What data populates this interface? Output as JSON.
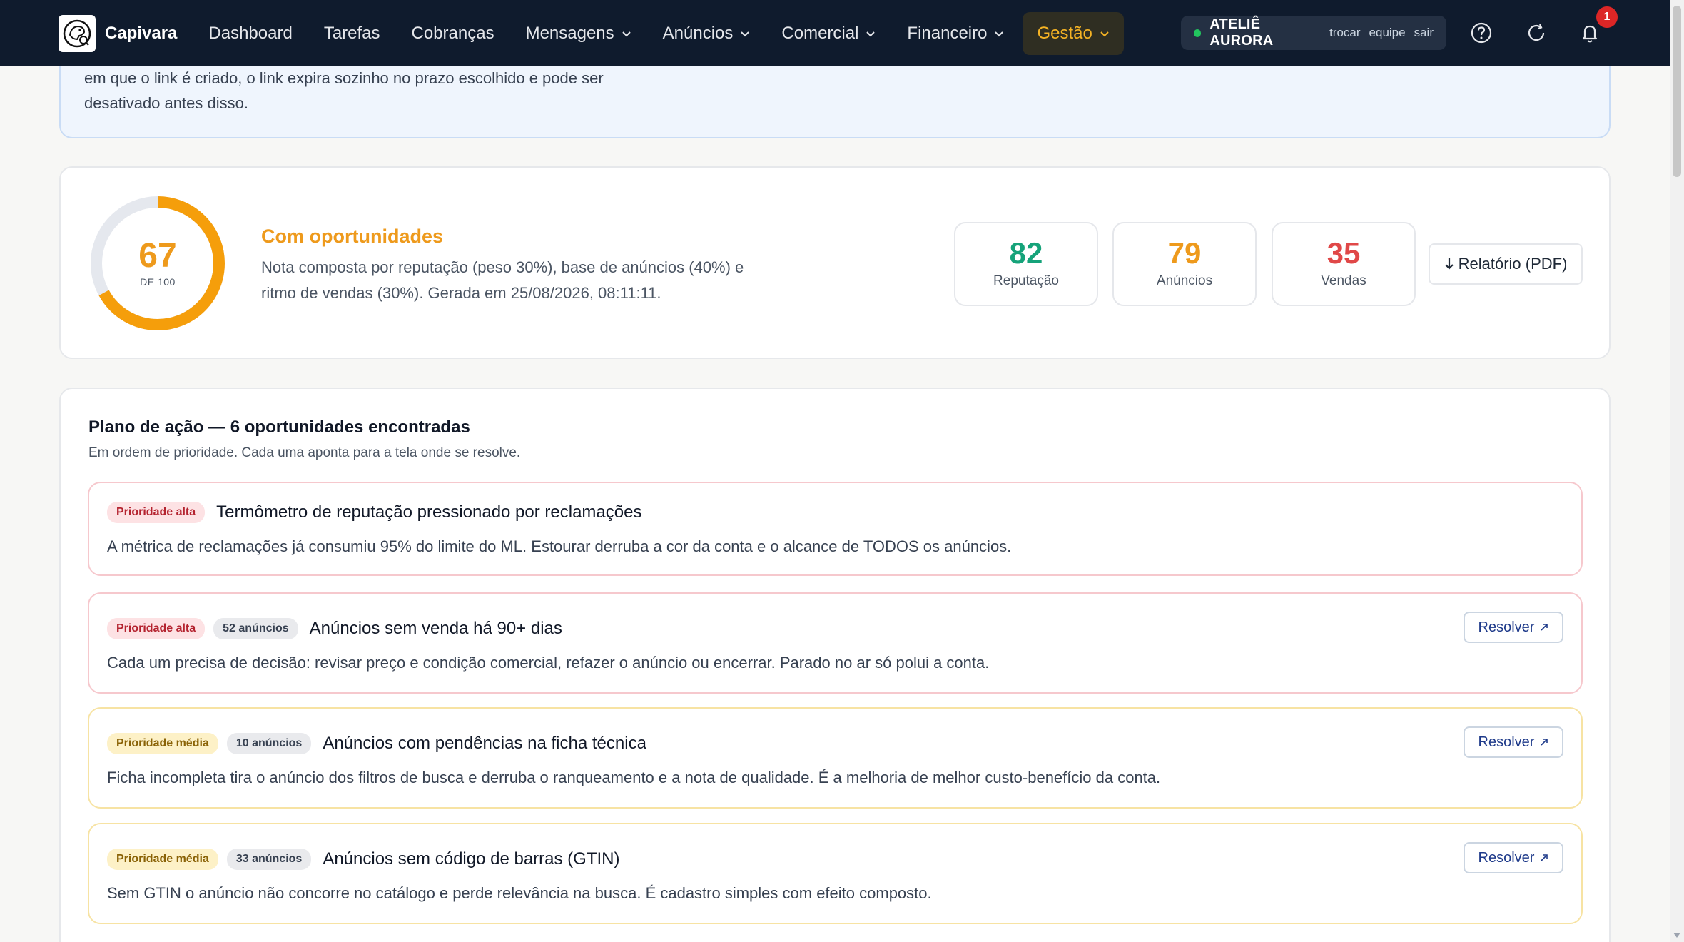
{
  "nav": {
    "brand": "Capivara",
    "items": [
      {
        "label": "Dashboard",
        "dropdown": false
      },
      {
        "label": "Tarefas",
        "dropdown": false
      },
      {
        "label": "Cobranças",
        "dropdown": false
      },
      {
        "label": "Mensagens",
        "dropdown": true
      },
      {
        "label": "Anúncios",
        "dropdown": true
      },
      {
        "label": "Comercial",
        "dropdown": true
      },
      {
        "label": "Financeiro",
        "dropdown": true
      },
      {
        "label": "Gestão",
        "dropdown": true,
        "active": true
      }
    ],
    "account": {
      "name": "ATELIÊ AURORA",
      "switch": "trocar",
      "team": "equipe",
      "logout": "sair"
    },
    "notifications_count": "1"
  },
  "info": {
    "text": "em que o link é criado, o link expira sozinho no prazo escolhido e pode ser desativado antes disso."
  },
  "score": {
    "value": "67",
    "max_label": "DE 100",
    "fraction": 0.67,
    "status": "Com oportunidades",
    "description": "Nota composta por reputação (peso 30%), base de anúncios (40%) e ritmo de vendas (30%). Gerada em 25/08/2026, 08:11:11.",
    "metrics": [
      {
        "value": "82",
        "label": "Reputação",
        "color": "#16a37a"
      },
      {
        "value": "79",
        "label": "Anúncios",
        "color": "#ee9a1c"
      },
      {
        "value": "35",
        "label": "Vendas",
        "color": "#e04848"
      }
    ],
    "pdf_button": "Relatório (PDF)"
  },
  "plan": {
    "title": "Plano de ação — 6 oportunidades encontradas",
    "subtitle": "Em ordem de prioridade. Cada uma aponta para a tela onde se resolve.",
    "resolve_label": "Resolver",
    "items": [
      {
        "priority": "Prioridade alta",
        "count": "",
        "title": "Termômetro de reputação pressionado por reclamações",
        "description": "A métrica de reclamações já consumiu 95% do limite do ML. Estourar derruba a cor da conta e o alcance de TODOS os anúncios."
      },
      {
        "priority": "Prioridade alta",
        "count": "52 anúncios",
        "title": "Anúncios sem venda há 90+ dias",
        "description": "Cada um precisa de decisão: revisar preço e condição comercial, refazer o anúncio ou encerrar. Parado no ar só polui a conta."
      },
      {
        "priority": "Prioridade média",
        "count": "10 anúncios",
        "title": "Anúncios com pendências na ficha técnica",
        "description": "Ficha incompleta tira o anúncio dos filtros de busca e derruba o ranqueamento e a nota de qualidade. É a melhoria de melhor custo-benefício da conta."
      },
      {
        "priority": "Prioridade média",
        "count": "33 anúncios",
        "title": "Anúncios sem código de barras (GTIN)",
        "description": "Sem GTIN o anúncio não concorre no catálogo e perde relevância na busca. É cadastro simples com efeito composto."
      }
    ]
  }
}
